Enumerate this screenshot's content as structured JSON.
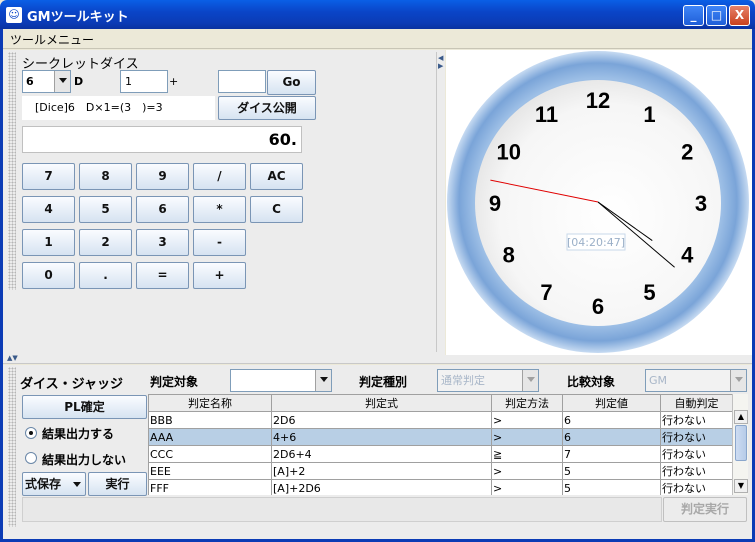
{
  "window": {
    "title": "GMツールキット",
    "app_icon": "cat-icon",
    "minimize": "_",
    "maximize": "□",
    "close": "X"
  },
  "menu": {
    "tool_menu": "ツールメニュー"
  },
  "secret_dice": {
    "title": "シークレットダイス",
    "dice_sides": "6",
    "d_label": "D",
    "count": "1",
    "plus_label": "+",
    "modifier": "",
    "go_button": "Go",
    "result": "[Dice]6　D×1=(3　)=3",
    "publish_button": "ダイス公開"
  },
  "calculator": {
    "display": "60.",
    "keys": [
      [
        "7",
        "8",
        "9",
        "/",
        "AC"
      ],
      [
        "4",
        "5",
        "6",
        "*",
        "C"
      ],
      [
        "1",
        "2",
        "3",
        "-"
      ],
      [
        "0",
        ".",
        "=",
        "+"
      ]
    ]
  },
  "clock": {
    "numbers": [
      "12",
      "1",
      "2",
      "3",
      "4",
      "5",
      "6",
      "7",
      "8",
      "9",
      "10",
      "11"
    ],
    "time_label": "[04:20:47]",
    "hour": 4,
    "minute": 20,
    "second": 47
  },
  "judge": {
    "title": "ダイス・ジャッジ",
    "target_label": "判定対象",
    "target_value": "",
    "type_label": "判定種別",
    "type_value": "通常判定",
    "compare_label": "比較対象",
    "compare_value": "GM",
    "pl_confirm_button": "PL確定",
    "output_on_label": "結果出力する",
    "output_off_label": "結果出力しない",
    "save_expr_button": "式保存",
    "run_button": "実行",
    "execute_judge_button": "判定実行",
    "columns": [
      "判定名称",
      "判定式",
      "判定方法",
      "判定値",
      "自動判定"
    ],
    "rows": [
      [
        "BBB",
        "2D6",
        ">",
        "6",
        "行わない"
      ],
      [
        "AAA",
        "4+6",
        ">",
        "6",
        "行わない"
      ],
      [
        "CCC",
        "2D6+4",
        "≧",
        "7",
        "行わない"
      ],
      [
        "EEE",
        "[A]+2",
        ">",
        "5",
        "行わない"
      ],
      [
        "FFF",
        "[A]+2D6",
        ">",
        "5",
        "行わない"
      ]
    ],
    "selected_row": 1
  }
}
